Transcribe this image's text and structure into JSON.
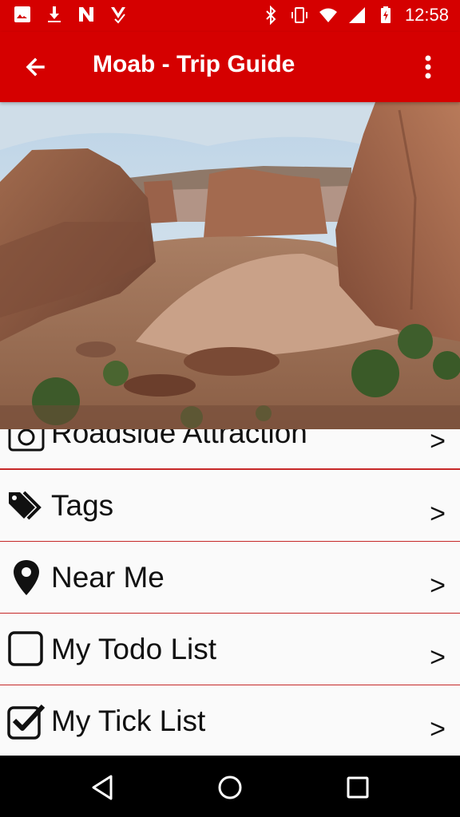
{
  "status_bar": {
    "time": "12:58",
    "left_icons": [
      "image-icon",
      "download-icon",
      "n-icon",
      "assignment-icon"
    ],
    "right_icons": [
      "bluetooth-icon",
      "vibrate-icon",
      "wifi-icon",
      "signal-icon",
      "battery-charging-icon"
    ]
  },
  "app_bar": {
    "title": "Moab - Trip Guide",
    "color": "#d50000"
  },
  "hero": {
    "icon": "landscape-photo"
  },
  "list": {
    "items": [
      {
        "label": "Roadside Attraction",
        "chevron": ">",
        "icon": "camera-icon"
      },
      {
        "label": "Tags",
        "chevron": ">",
        "icon": "tags-icon"
      },
      {
        "label": "Near Me",
        "chevron": ">",
        "icon": "location-pin-icon"
      },
      {
        "label": "My Todo List",
        "chevron": ">",
        "icon": "checkbox-empty-icon"
      },
      {
        "label": "My Tick List",
        "chevron": ">",
        "icon": "checkbox-checked-icon"
      }
    ],
    "divider_color": "#c62828"
  },
  "nav_bar": {
    "buttons": [
      "back-icon",
      "home-icon",
      "recents-icon"
    ]
  }
}
